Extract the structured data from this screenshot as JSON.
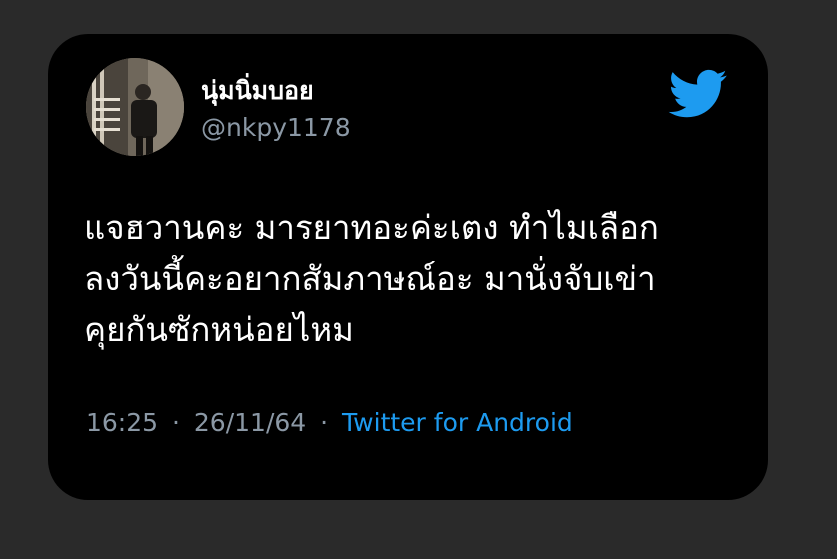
{
  "tweet": {
    "display_name": "นุ่มนิ่มบอย",
    "handle": "@nkpy1178",
    "text_lines": [
      "แจฮวานคะ มารยาทอะค่ะเตง ทำไมเลือก",
      "ลงวันนี้คะอยากสัมภาษณ์อะ มานั่งจับเข่า",
      "คุยกันซักหน่อยไหม"
    ],
    "time": "16:25",
    "date": "26/11/64",
    "separator": "·",
    "source": "Twitter for Android"
  },
  "icons": {
    "brand": "twitter-bird-icon",
    "avatar": "user-avatar-photo"
  },
  "colors": {
    "background": "#2a2a2a",
    "card": "#000000",
    "text": "#ffffff",
    "muted": "#8b98a5",
    "accent": "#1d9bf0"
  }
}
